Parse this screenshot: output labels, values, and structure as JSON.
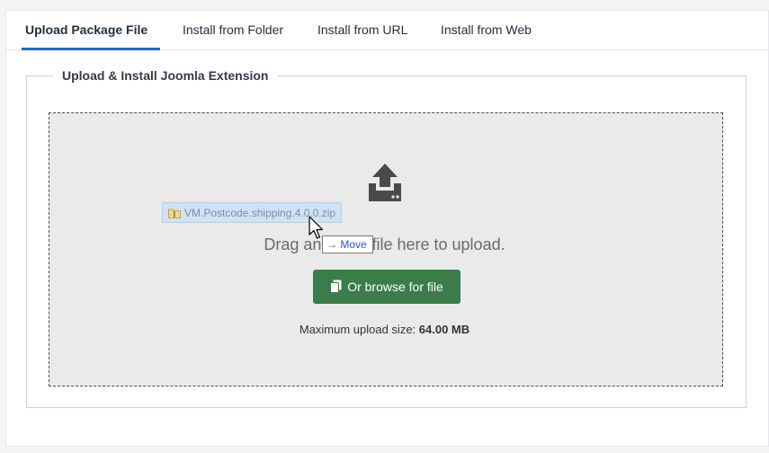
{
  "tabs": [
    {
      "label": "Upload Package File",
      "active": true
    },
    {
      "label": "Install from Folder",
      "active": false
    },
    {
      "label": "Install from URL",
      "active": false
    },
    {
      "label": "Install from Web",
      "active": false
    }
  ],
  "fieldset": {
    "legend": "Upload & Install Joomla Extension"
  },
  "dropzone": {
    "upload_icon": "upload-icon",
    "drop_text": "Drag and drop file here to upload.",
    "browse_label": "Or browse for file",
    "browse_icon": "copy-icon",
    "max_size_label": "Maximum upload size:",
    "max_size_value": "64.00 MB"
  },
  "drag": {
    "file_name": "VM.Postcode.shipping.4.0.0.zip",
    "file_icon": "zip-folder-icon",
    "tooltip": "Move",
    "tooltip_icon": "arrow-right-icon"
  },
  "colors": {
    "accent": "#2a69b8",
    "button": "#3a7d4a",
    "dropzone_bg": "#eaeaea"
  }
}
